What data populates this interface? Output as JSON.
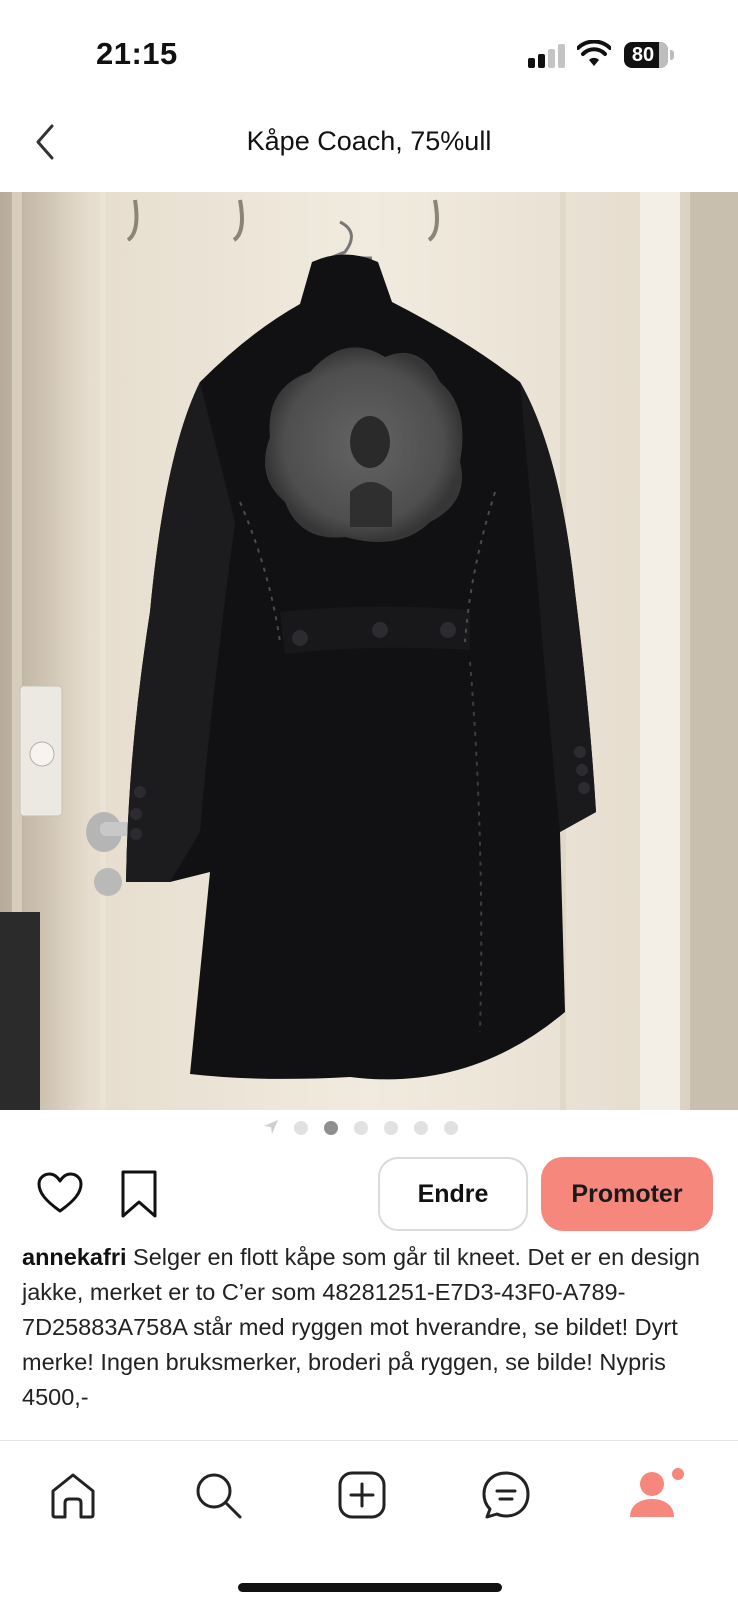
{
  "status_bar": {
    "time": "21:15",
    "battery": "80"
  },
  "header": {
    "title": "Kåpe Coach, 75%ull"
  },
  "photo": {
    "description_icon": "coat-photo",
    "dots_count": 6,
    "active_dot_index": 1
  },
  "actions": {
    "edit_label": "Endre",
    "promote_label": "Promoter",
    "promote_color": "#f6877c"
  },
  "caption": {
    "username": "annekafri",
    "text": " Selger en flott kåpe som går til kneet. Det er en design jakke, merket er to C’er som 48281251-E7D3-43F0-A789-7D25883A758A står med ryggen mot hverandre, se bildet! Dyrt merke! Ingen bruksmerker, broderi på ryggen, se bilde! Nypris 4500,-"
  },
  "tabbar": {
    "items": [
      {
        "icon": "home-icon"
      },
      {
        "icon": "search-icon"
      },
      {
        "icon": "add-icon"
      },
      {
        "icon": "messages-icon"
      },
      {
        "icon": "profile-icon"
      }
    ],
    "accent": "#f6877c"
  }
}
